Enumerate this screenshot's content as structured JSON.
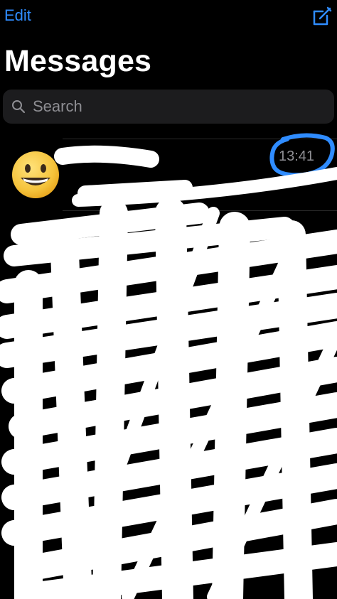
{
  "nav": {
    "edit_label": "Edit",
    "compose_icon": "compose-square-icon"
  },
  "header": {
    "title": "Messages"
  },
  "search": {
    "placeholder": "Search",
    "icon": "search-icon"
  },
  "conversations": [
    {
      "avatar_icon": "grinning-face-icon",
      "time": "13:41"
    }
  ],
  "colors": {
    "accent": "#2f8cff",
    "background": "#000000",
    "search_bg": "#1c1c1e",
    "secondary_text": "#8e8e93",
    "annotation": "#2f8cff",
    "redaction": "#ffffff"
  }
}
